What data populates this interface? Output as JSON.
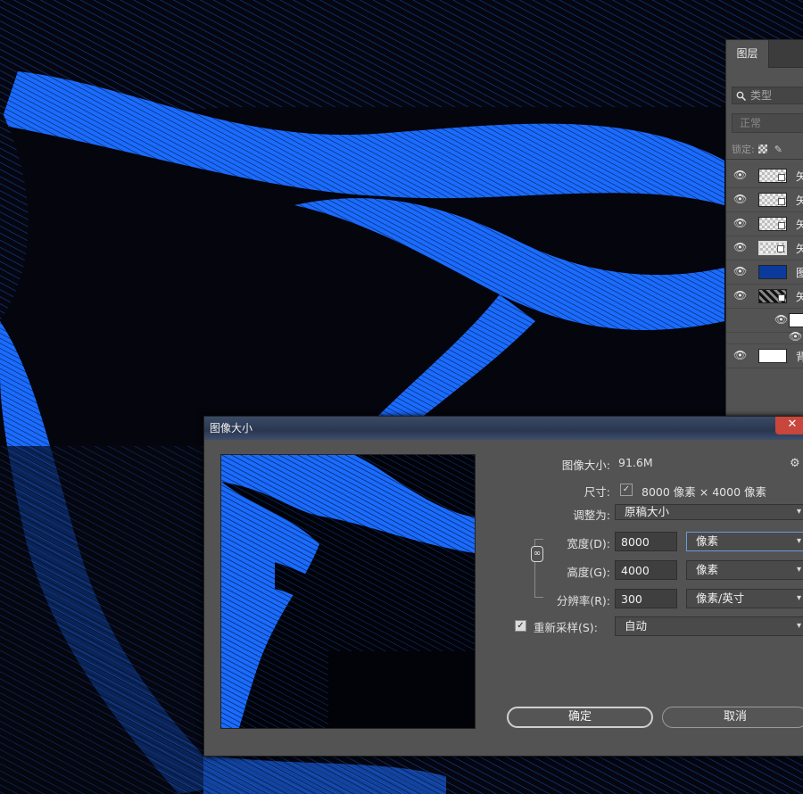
{
  "layers_panel": {
    "tab_label": "图层",
    "search_placeholder": "类型",
    "blend_mode": "正常",
    "lock_label": "锁定:",
    "layers": [
      {
        "name": "矢",
        "thumb": "checker",
        "icon": "eye-icon"
      },
      {
        "name": "矢",
        "thumb": "checker",
        "icon": "eye-icon"
      },
      {
        "name": "矢",
        "thumb": "checker",
        "icon": "eye-icon"
      },
      {
        "name": "矢",
        "thumb": "checker",
        "icon": "eye-icon"
      },
      {
        "name": "图",
        "thumb": "blue",
        "icon": "eye-icon"
      },
      {
        "name": "矢",
        "thumb": "photo",
        "icon": "eye-icon"
      },
      {
        "name": "背",
        "thumb": "white",
        "icon": "eye-icon"
      }
    ]
  },
  "dialog": {
    "title": "图像大小",
    "close_glyph": "✕",
    "image_size_label": "图像大小:",
    "image_size_value": "91.6M",
    "dimensions_label": "尺寸:",
    "dimensions_value": "8000 像素 × 4000 像素",
    "fit_to_label": "调整为:",
    "fit_to_value": "原稿大小",
    "width_label": "宽度(D):",
    "width_value": "8000",
    "width_unit": "像素",
    "height_label": "高度(G):",
    "height_value": "4000",
    "height_unit": "像素",
    "resolution_label": "分辨率(R):",
    "resolution_value": "300",
    "resolution_unit": "像素/英寸",
    "resample_label": "重新采样(S):",
    "resample_checked": true,
    "resample_value": "自动",
    "ok_label": "确定",
    "cancel_label": "取消"
  },
  "colors": {
    "accent_blue": "#1a6bff",
    "canvas_dark": "#05060f",
    "panel_gray": "#535353"
  }
}
